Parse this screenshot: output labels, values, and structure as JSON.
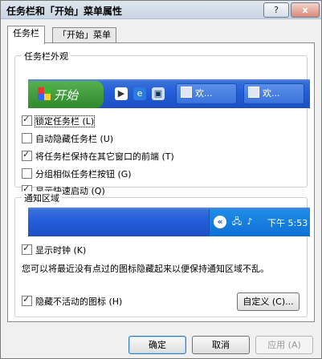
{
  "window": {
    "title": "任务栏和「开始」菜单属性",
    "help_btn": "?",
    "close_btn": "x"
  },
  "tabs": [
    {
      "label": "任务栏"
    },
    {
      "label": "「开始」菜单"
    }
  ],
  "appearance": {
    "legend": "任务栏外观",
    "start_label": "开始",
    "task_buttons": [
      {
        "label": "欢..."
      },
      {
        "label": "欢..."
      }
    ],
    "options": [
      {
        "label": "锁定任务栏 (L)",
        "checked": true
      },
      {
        "label": "自动隐藏任务栏 (U)",
        "checked": false
      },
      {
        "label": "将任务栏保持在其它窗口的前端 (T)",
        "checked": true
      },
      {
        "label": "分组相似任务栏按钮 (G)",
        "checked": false
      },
      {
        "label": "显示快速启动 (Q)",
        "checked": true
      }
    ]
  },
  "notification": {
    "legend": "通知区域",
    "clock": "下午 5:53",
    "show_clock": {
      "label": "显示时钟 (K)",
      "checked": true
    },
    "description": "您可以将最近没有点过的图标隐藏起来以便保持通知区域不乱。",
    "hide_inactive": {
      "label": "隐藏不活动的图标 (H)",
      "checked": true
    },
    "customize_label": "自定义 (C)..."
  },
  "footer": {
    "ok": "确定",
    "cancel": "取消",
    "apply": "应用 (A)"
  }
}
